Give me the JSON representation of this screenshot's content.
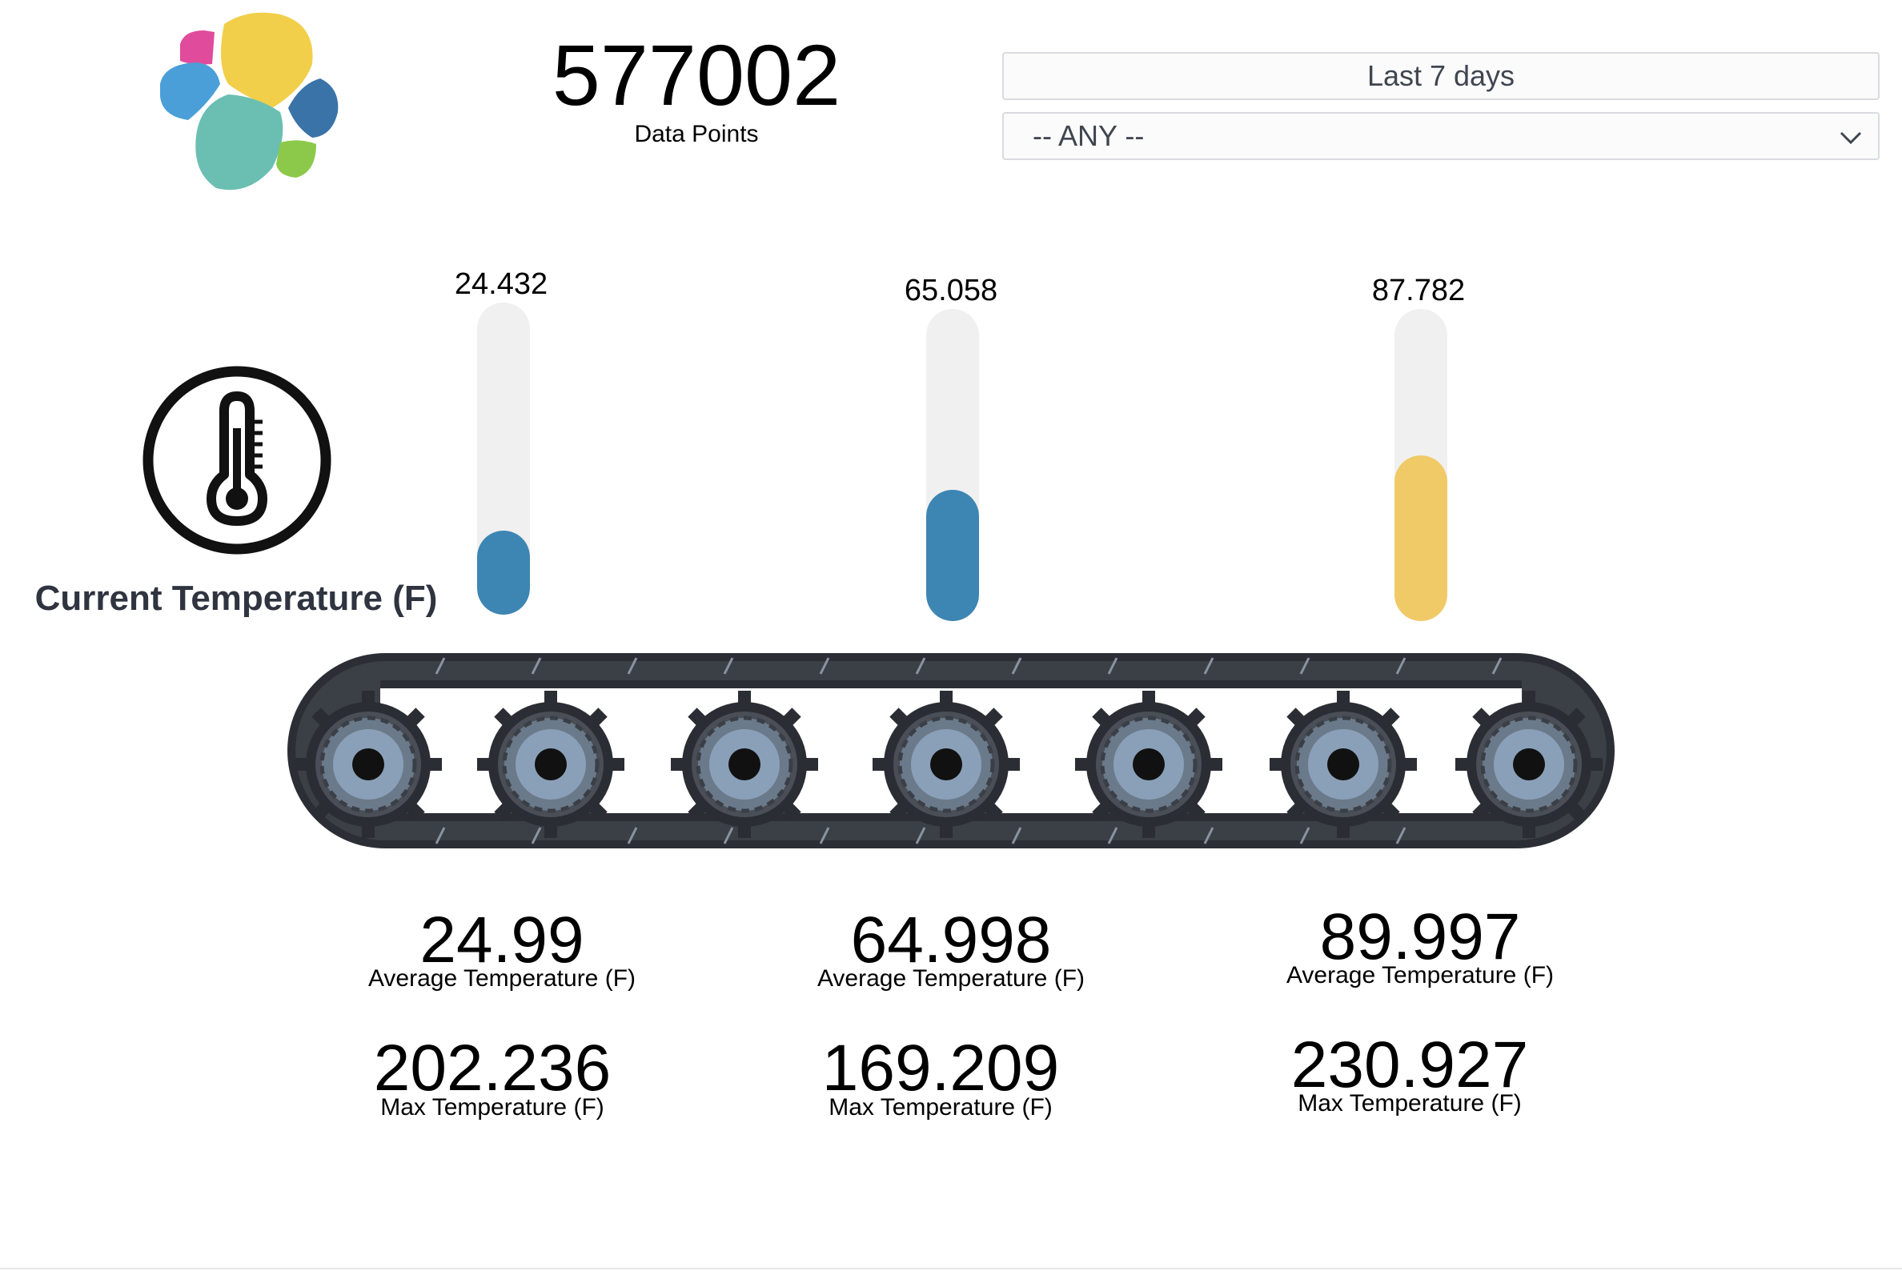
{
  "header": {
    "data_points_value": "577002",
    "data_points_label": "Data Points",
    "time_filter": "Last 7 days",
    "any_filter": "-- ANY --"
  },
  "current_temperature": {
    "title": "Current Temperature (F)"
  },
  "gauges": [
    {
      "value_label": "24.432",
      "fill_fraction": 0.27,
      "color": "#3d86b3"
    },
    {
      "value_label": "65.058",
      "fill_fraction": 0.42,
      "color": "#3d86b3"
    },
    {
      "value_label": "87.782",
      "fill_fraction": 0.53,
      "color": "#f0ca66"
    }
  ],
  "stats": [
    {
      "avg_value": "24.99",
      "avg_label": "Average Temperature (F)",
      "max_value": "202.236",
      "max_label": "Max Temperature (F)"
    },
    {
      "avg_value": "64.998",
      "avg_label": "Average Temperature (F)",
      "max_value": "169.209",
      "max_label": "Max Temperature (F)"
    },
    {
      "avg_value": "89.997",
      "avg_label": "Average Temperature (F)",
      "max_value": "230.927",
      "max_label": "Max Temperature (F)"
    }
  ],
  "icons": {
    "logo": "elastic-logo",
    "thermometer": "thermometer-icon",
    "dropdown": "chevron-down-icon",
    "conveyor": "conveyor-belt-illustration"
  },
  "colors": {
    "logo_yellow": "#f2cf4a",
    "logo_teal": "#6bbfb2",
    "logo_blue": "#4a9fd8",
    "logo_navy": "#3a73a8",
    "logo_pink": "#e14b9b",
    "logo_green": "#8cc94b",
    "gauge_track": "#f0f0f0",
    "gauge_blue": "#3d86b3",
    "gauge_yellow": "#f0ca66"
  }
}
